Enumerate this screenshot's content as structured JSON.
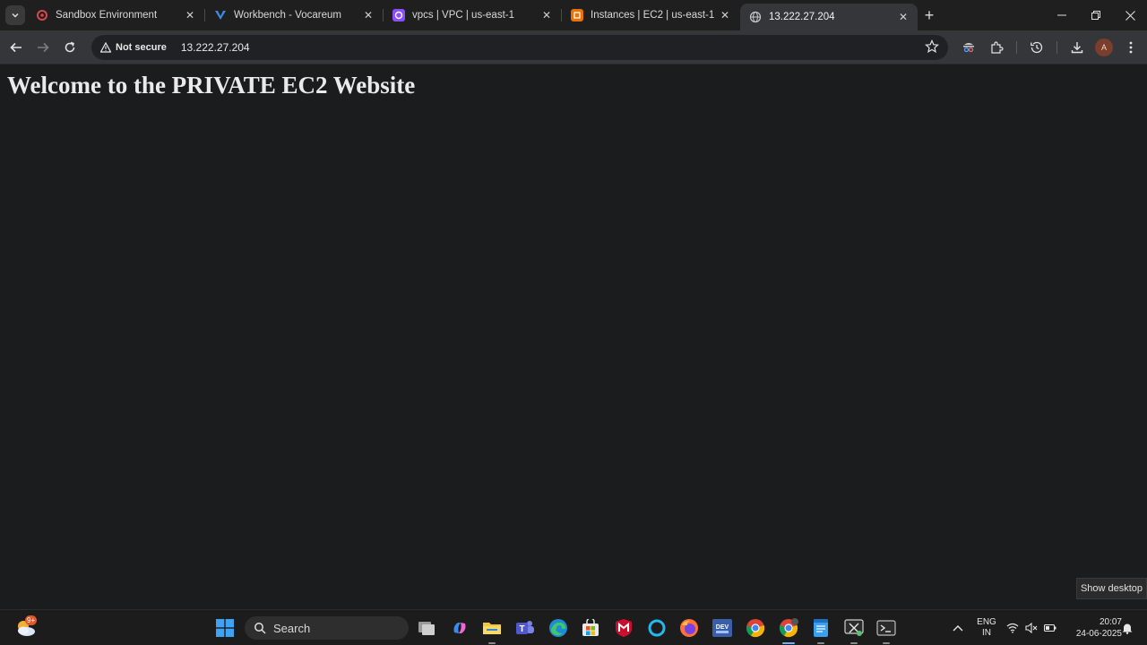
{
  "browser": {
    "tabs": [
      {
        "title": "Sandbox Environment",
        "icon": "sandbox-icon"
      },
      {
        "title": "Workbench - Vocareum",
        "icon": "vocareum-icon"
      },
      {
        "title": "vpcs | VPC | us-east-1",
        "icon": "vpc-icon"
      },
      {
        "title": "Instances | EC2 | us-east-1",
        "icon": "ec2-icon"
      },
      {
        "title": "13.222.27.204",
        "icon": "globe-icon",
        "active": true
      }
    ],
    "security_label": "Not secure",
    "url": "13.222.27.204",
    "profile_initial": "A"
  },
  "page": {
    "heading": "Welcome to the PRIVATE EC2 Website"
  },
  "show_desktop": "Show desktop",
  "taskbar": {
    "weather_badge": "9+",
    "search_placeholder": "Search",
    "language": "ENG",
    "region": "IN",
    "time": "20:07",
    "date": "24-06-2025"
  },
  "colors": {
    "page_bg": "#1b1c1e",
    "toolbar_bg": "#35363a",
    "accent": "#6ab0ff"
  }
}
